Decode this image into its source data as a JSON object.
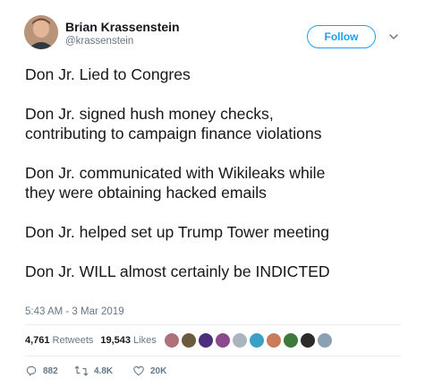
{
  "author": {
    "display_name": "Brian Krassenstein",
    "handle": "@krassenstein",
    "avatar_icon": "profile-photo"
  },
  "follow_button": {
    "label": "Follow",
    "color": "#1da1f2"
  },
  "tweet": {
    "paragraphs": [
      [
        "Don Jr. Lied to Congres"
      ],
      [
        "Don Jr. signed hush money checks,",
        "contributing to campaign finance violations"
      ],
      [
        "Don Jr. communicated with Wikileaks while",
        "they were obtaining hacked emails"
      ],
      [
        "Don Jr. helped set up Trump Tower meeting"
      ],
      [
        "Don Jr. WILL almost certainly be INDICTED"
      ]
    ]
  },
  "timestamp": "5:43 AM - 3 Mar 2019",
  "stats": {
    "retweets_count": "4,761",
    "retweets_label": "Retweets",
    "likes_count": "19,543",
    "likes_label": "Likes"
  },
  "liker_avatars": [
    "#b0707a",
    "#6b5a3e",
    "#4b2f7a",
    "#8b4a8c",
    "#aab4be",
    "#3aa0c8",
    "#c97b5a",
    "#3d7a3a",
    "#2b2b2b",
    "#8aa0b4"
  ],
  "actions": {
    "reply_count": "882",
    "retweet_count": "4.8K",
    "like_count": "20K"
  },
  "colors": {
    "text": "#14171a",
    "secondary": "#657786",
    "accent": "#1da1f2",
    "divider": "#e6ecf0"
  }
}
